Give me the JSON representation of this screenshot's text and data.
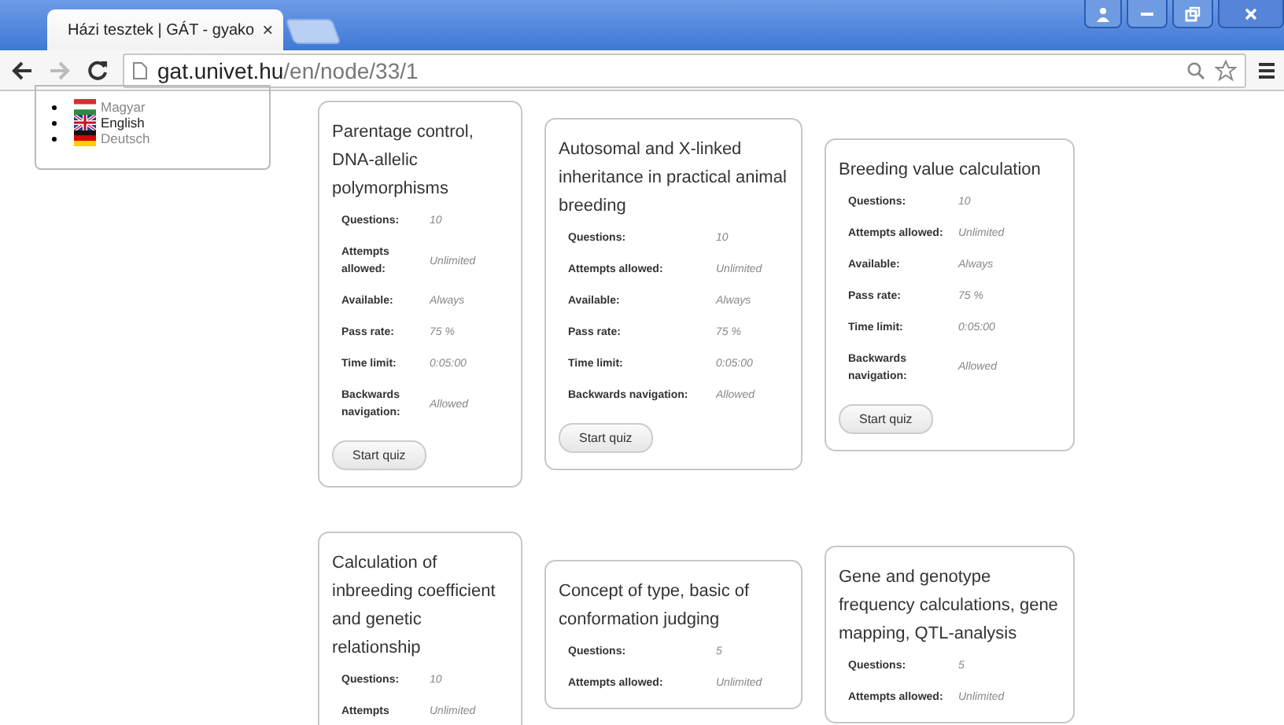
{
  "browser": {
    "tab": {
      "title": "Házi tesztek | GÁT - gyako",
      "close": "×"
    },
    "address": {
      "host": "gat.univet.hu",
      "path": "/en/node/33/1"
    }
  },
  "languages": [
    {
      "kind": "hu",
      "label": "Magyar",
      "selected": false
    },
    {
      "kind": "gb",
      "label": "English",
      "selected": true
    },
    {
      "kind": "de",
      "label": "Deutsch",
      "selected": false
    }
  ],
  "quiz_rows": [
    {
      "cards": [
        {
          "title": "Parentage control, DNA-allelic polymorphisms",
          "fields": [
            {
              "label": "Questions:",
              "value": "10"
            },
            {
              "label": "Attempts allowed:",
              "value": "Unlimited"
            },
            {
              "label": "Available:",
              "value": "Always"
            },
            {
              "label": "Pass rate:",
              "value": "75 %"
            },
            {
              "label": "Time limit:",
              "value": "0:05:00"
            },
            {
              "label": "Backwards navigation:",
              "value": "Allowed"
            }
          ],
          "button": "Start quiz"
        },
        {
          "title": "Autosomal and X-linked inheritance in practical animal breeding",
          "fields": [
            {
              "label": "Questions:",
              "value": "10"
            },
            {
              "label": "Attempts allowed:",
              "value": "Unlimited"
            },
            {
              "label": "Available:",
              "value": "Always"
            },
            {
              "label": "Pass rate:",
              "value": "75 %"
            },
            {
              "label": "Time limit:",
              "value": "0:05:00"
            },
            {
              "label": "Backwards navigation:",
              "value": "Allowed"
            }
          ],
          "button": "Start quiz"
        },
        {
          "title": "Breeding value calculation",
          "fields": [
            {
              "label": "Questions:",
              "value": "10"
            },
            {
              "label": "Attempts allowed:",
              "value": "Unlimited"
            },
            {
              "label": "Available:",
              "value": "Always"
            },
            {
              "label": "Pass rate:",
              "value": "75 %"
            },
            {
              "label": "Time limit:",
              "value": "0:05:00"
            },
            {
              "label": "Backwards navigation:",
              "value": "Allowed"
            }
          ],
          "button": "Start quiz"
        }
      ]
    },
    {
      "cards": [
        {
          "title": "Calculation of inbreeding coefficient and genetic relationship",
          "fields": [
            {
              "label": "Questions:",
              "value": "10"
            },
            {
              "label": "Attempts",
              "value": "Unlimited"
            }
          ]
        },
        {
          "title": "Concept of type, basic of conformation judging",
          "fields": [
            {
              "label": "Questions:",
              "value": "5"
            },
            {
              "label": "Attempts allowed:",
              "value": "Unlimited"
            }
          ]
        },
        {
          "title": "Gene and genotype frequency calculations, gene mapping, QTL-analysis",
          "fields": [
            {
              "label": "Questions:",
              "value": "5"
            },
            {
              "label": "Attempts allowed:",
              "value": "Unlimited"
            }
          ]
        }
      ]
    }
  ]
}
